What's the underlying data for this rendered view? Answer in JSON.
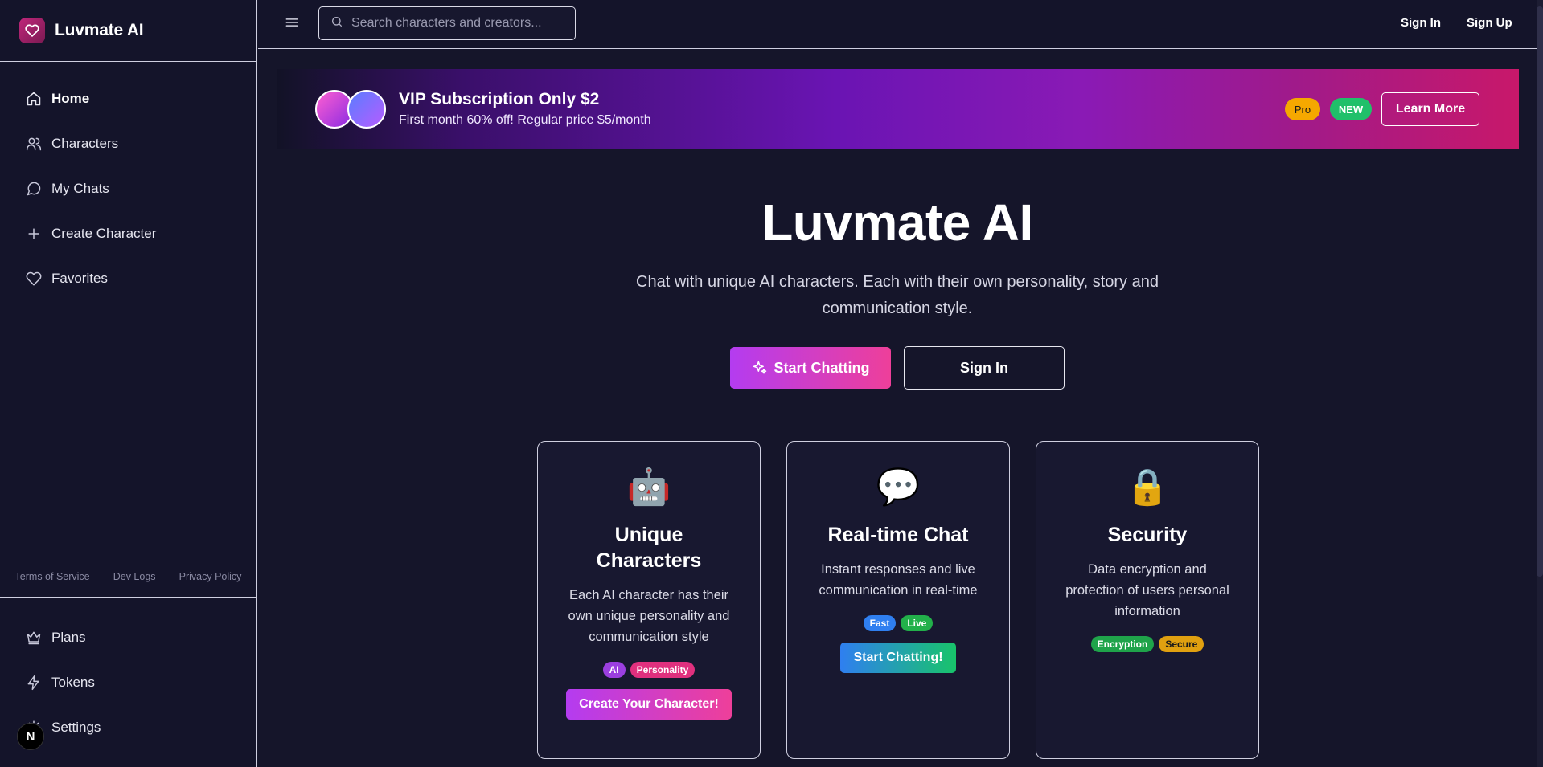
{
  "app": {
    "name": "Luvmate AI"
  },
  "sidebar": {
    "items": [
      {
        "label": "Home",
        "icon": "home-icon"
      },
      {
        "label": "Characters",
        "icon": "users-icon"
      },
      {
        "label": "My Chats",
        "icon": "chat-bubble-icon"
      },
      {
        "label": "Create Character",
        "icon": "plus-icon"
      },
      {
        "label": "Favorites",
        "icon": "heart-icon"
      }
    ],
    "footer_links": [
      "Terms of Service",
      "Dev Logs",
      "Privacy Policy"
    ],
    "bottom_items": [
      {
        "label": "Plans",
        "icon": "crown-icon"
      },
      {
        "label": "Tokens",
        "icon": "lightning-icon"
      },
      {
        "label": "Settings",
        "icon": "gear-icon"
      }
    ],
    "badge": "N"
  },
  "topbar": {
    "search_placeholder": "Search characters and creators...",
    "sign_in": "Sign In",
    "sign_up": "Sign Up"
  },
  "banner": {
    "title": "VIP Subscription Only $2",
    "subtitle": "First month 60% off! Regular price $5/month",
    "pill_pro": "Pro",
    "pill_new": "NEW",
    "cta": "Learn More"
  },
  "hero": {
    "title": "Luvmate AI",
    "subtitle": "Chat with unique AI characters. Each with their own personality, story and communication style.",
    "start_button": "Start Chatting",
    "signin_button": "Sign In"
  },
  "cards": [
    {
      "emoji": "🤖",
      "title": "Unique Characters",
      "text": "Each AI character has their own unique personality and communication style",
      "tags": [
        "AI",
        "Personality"
      ],
      "button": "Create Your Character!"
    },
    {
      "emoji": "💬",
      "title": "Real-time Chat",
      "text": "Instant responses and live communication in real-time",
      "tags": [
        "Fast",
        "Live"
      ],
      "button": "Start Chatting!"
    },
    {
      "emoji": "🔒",
      "title": "Security",
      "text": "Data encryption and protection of users personal information",
      "tags": [
        "Encryption",
        "Secure"
      ],
      "button": ""
    }
  ],
  "colors": {
    "background": "#15152a",
    "accent_pink": "#ee3f9a",
    "accent_purple": "#b43cf0",
    "pill_pro": "#f5a800",
    "pill_new": "#20c06a",
    "tag_ai": "#9b3fe0",
    "tag_personality": "#e0307e",
    "tag_fast": "#2f7ff0",
    "tag_live": "#22b04a",
    "tag_encryption": "#1fa34a",
    "tag_secure": "#e0a010"
  }
}
